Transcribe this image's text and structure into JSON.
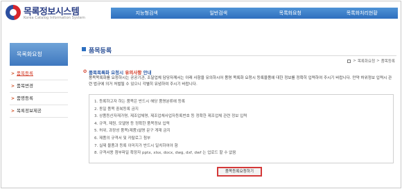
{
  "header": {
    "logo_title": "목록정보시스템",
    "logo_subtitle": "Korea Catalog Information System",
    "nav": [
      {
        "label": "지능형검색"
      },
      {
        "label": "일반검색"
      },
      {
        "label": "목록화요청"
      },
      {
        "label": "목록화처리현황"
      }
    ]
  },
  "sidebar": {
    "title": "목록화요청",
    "items": [
      {
        "label": "품목등록",
        "active": true
      },
      {
        "label": "품목변경",
        "active": false
      },
      {
        "label": "품명등록",
        "active": false
      },
      {
        "label": "목록정보제공",
        "active": false
      }
    ]
  },
  "main": {
    "title": "품목등록",
    "breadcrumb": [
      "목록화요청",
      "품목등록"
    ],
    "notice_head_prefix": "품목목록화 요청시",
    "notice_head_warn": "유의사항",
    "notice_head_suffix": "안내",
    "notice_body": "품목목록화를 요청하시는 공공기관, 조달업체 담당자께서는 아래 사항을 유의하시어 품명 목록화 요청시 등록물품에 대한 정보를 정확히 입력하여 주시기 바랍니다. 만약 허위정보 입력시 관련 법규에 의거 처벌될 수 있으니 각별히 유념하여 주시기 바랍니다.",
    "rules": [
      "1. 등록하고자 하는 품목은 반드시 해당 품명분류에 등록",
      "2. 동일 품목 중복등록 금지",
      "3. 상품등산자재가명, 제조업체명, 제조업체사업자등록번호 등 정확한 제조업체 관련 정보 입력",
      "4. 규격, 제원, 모델명 등 정확한 품목정보 입력",
      "5. 허위, 과장성 품목(제품)설명 문구 게재 금지",
      "6. 제품의 규격서 및 카탈로그 첨부",
      "7. 실제 물품과 등록 이미지가 반드시 일치하여야 함",
      "8. 규격서용 첨부파일 확장자 pptx, xlsx, docx, dwg, dxf, dwf 는 업로드 할 수 없음"
    ],
    "request_button": "품목등록요청하기"
  }
}
